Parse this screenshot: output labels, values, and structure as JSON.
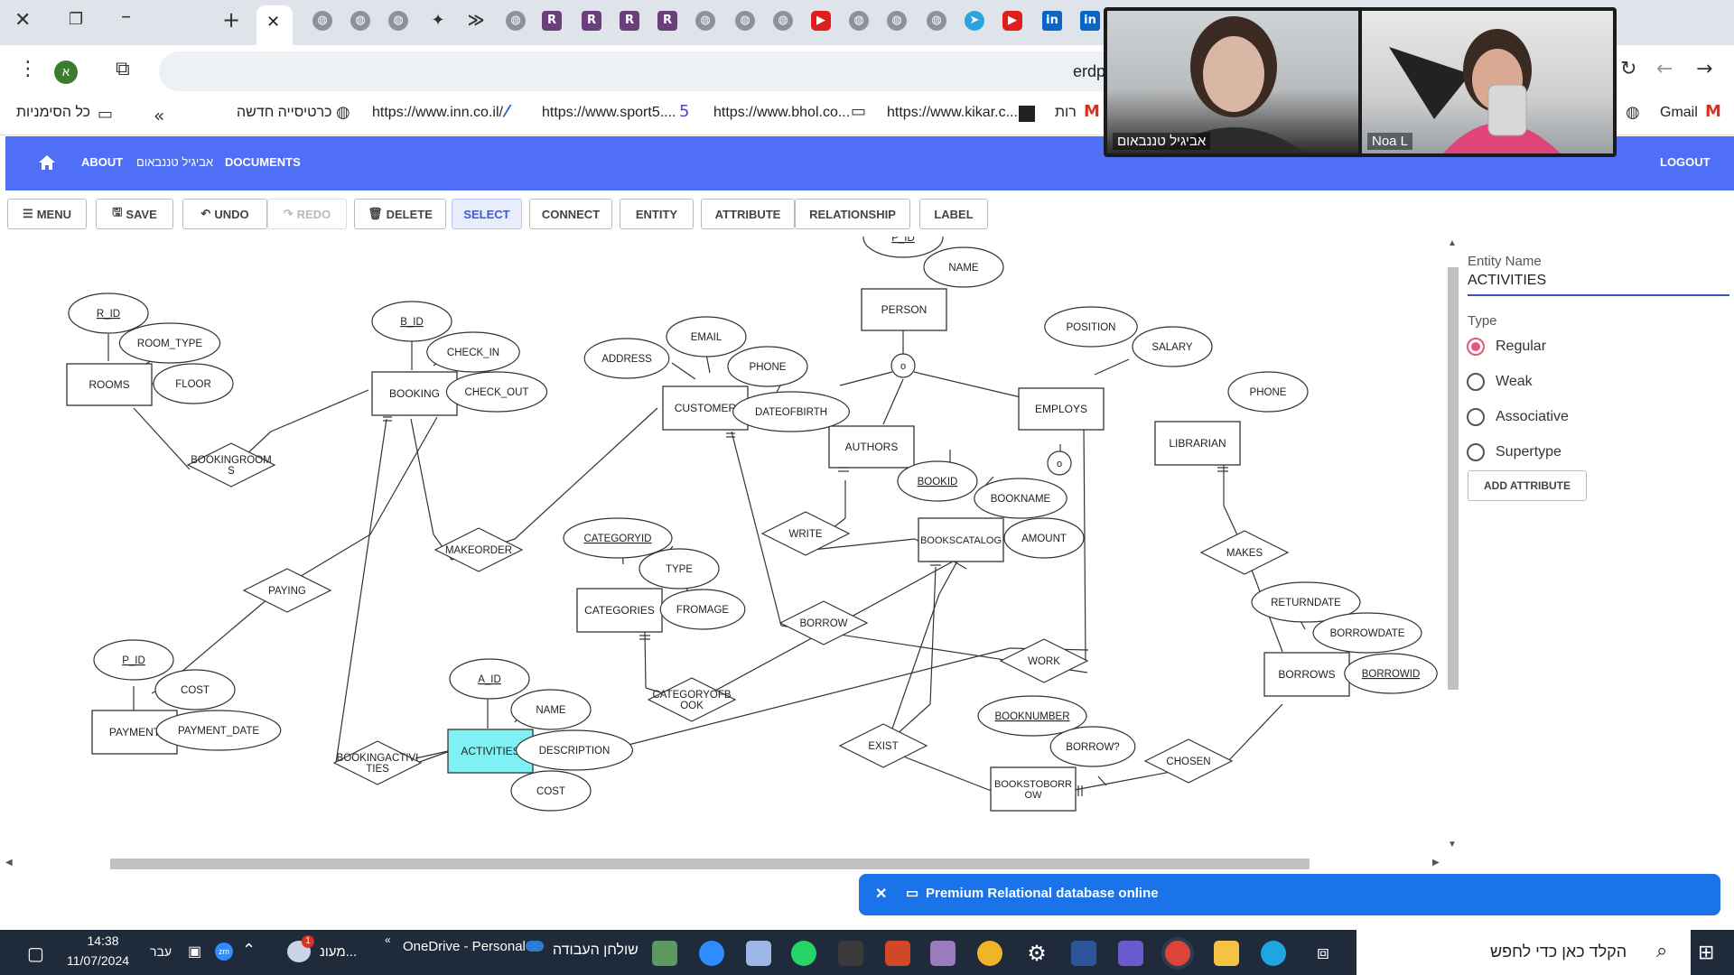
{
  "browser": {
    "address_partial": "erdp",
    "tab_icons": [
      "globe-icon",
      "openai-icon",
      "globe-icon",
      "gemini-icon",
      "terminal-icon",
      "globe-icon",
      "R",
      "R",
      "R",
      "R",
      "globe-icon",
      "camera-icon",
      "globe-icon",
      "youtube-icon",
      "globe-icon",
      "globe-icon",
      "globe-icon",
      "telegram-icon",
      "youtube-icon",
      "linkedin-icon",
      "linkedin-icon"
    ],
    "bookmarks": [
      {
        "label": "כל הסימניות"
      },
      {
        "label": "כרטיסייה חדשה"
      },
      {
        "label": "https://www.inn.co.il/"
      },
      {
        "label": "https://www.sport5...."
      },
      {
        "label": "https://www.bhol.co..."
      },
      {
        "label": "https://www.kikar.c..."
      },
      {
        "label": "רות"
      },
      {
        "label": "Gmail"
      }
    ]
  },
  "video_call": {
    "participants": [
      {
        "name": "אביגיל טננבאום"
      },
      {
        "name": "Noa L"
      }
    ]
  },
  "app": {
    "nav": {
      "about": "ABOUT",
      "user": "אביגיל טננבאום",
      "documents": "DOCUMENTS",
      "logout": "LOGOUT"
    },
    "tools": {
      "menu": "MENU",
      "save": "SAVE",
      "undo": "UNDO",
      "redo": "REDO",
      "delete": "DELETE",
      "select": "SELECT",
      "connect": "CONNECT",
      "entity": "ENTITY",
      "attribute": "ATTRIBUTE",
      "relationship": "RELATIONSHIP",
      "label": "LABEL"
    },
    "panel": {
      "entity_name_label": "Entity Name",
      "entity_name_value": "ACTIVITIES",
      "type_label": "Type",
      "types": [
        "Regular",
        "Weak",
        "Associative",
        "Supertype"
      ],
      "selected_type": "Regular",
      "add_attribute": "ADD ATTRIBUTE"
    },
    "toast": "Premium Relational database online"
  },
  "diagram": {
    "entities": [
      {
        "label": "ROOMS"
      },
      {
        "label": "BOOKING"
      },
      {
        "label": "CUSTOMER"
      },
      {
        "label": "PERSON"
      },
      {
        "label": "AUTHORS"
      },
      {
        "label": "EMPLOYS"
      },
      {
        "label": "LIBRARIAN"
      },
      {
        "label": "BOOKSCATALOG"
      },
      {
        "label": "CATEGORIES"
      },
      {
        "label": "PAYMENT"
      },
      {
        "label": "ACTIVITIES",
        "selected": true
      },
      {
        "label": "BORROWS"
      },
      {
        "label": "BOOKSTOBORR\nOW"
      }
    ],
    "attributes": [
      {
        "label": "R_ID",
        "key": true
      },
      {
        "label": "ROOM_TYPE"
      },
      {
        "label": "FLOOR"
      },
      {
        "label": "B_ID",
        "key": true
      },
      {
        "label": "CHECK_IN"
      },
      {
        "label": "CHECK_OUT"
      },
      {
        "label": "ADDRESS"
      },
      {
        "label": "EMAIL"
      },
      {
        "label": "PHONE"
      },
      {
        "label": "DATEOFBIRTH"
      },
      {
        "label": "P_ID",
        "key": true
      },
      {
        "label": "NAME"
      },
      {
        "label": "POSITION"
      },
      {
        "label": "SALARY"
      },
      {
        "label": "PHONE"
      },
      {
        "label": "BOOKID",
        "key": true
      },
      {
        "label": "BOOKNAME"
      },
      {
        "label": "AMOUNT"
      },
      {
        "label": "CATEGORYID",
        "key": true
      },
      {
        "label": "TYPE"
      },
      {
        "label": "FROMAGE"
      },
      {
        "label": "P_ID",
        "key": true
      },
      {
        "label": "COST"
      },
      {
        "label": "PAYMENT_DATE"
      },
      {
        "label": "A_ID",
        "key": true
      },
      {
        "label": "NAME"
      },
      {
        "label": "DESCRIPTION"
      },
      {
        "label": "COST"
      },
      {
        "label": "RETURNDATE"
      },
      {
        "label": "BORROWDATE"
      },
      {
        "label": "BORROWID",
        "key": true
      },
      {
        "label": "BOOKNUMBER",
        "key": true
      },
      {
        "label": "BORROW?"
      }
    ],
    "relationships": [
      {
        "label": "BOOKINGROOM\nS"
      },
      {
        "label": "MAKEORDER"
      },
      {
        "label": "PAYING"
      },
      {
        "label": "WRITE"
      },
      {
        "label": "BORROW"
      },
      {
        "label": "WORK"
      },
      {
        "label": "MAKES"
      },
      {
        "label": "CATEGORYOFB\nOOK"
      },
      {
        "label": "BOOKINGACTIVI\nTIES"
      },
      {
        "label": "EXIST"
      },
      {
        "label": "CHOSEN"
      }
    ],
    "isa_symbol": "o"
  },
  "taskbar": {
    "time": "14:38",
    "date": "11/07/2024",
    "lang": "עבר",
    "search_placeholder": "הקלד כאן כדי לחפש",
    "onedrive": "OneDrive - Personal",
    "desktop": "שולחן העבודה",
    "weather": "מעונ...",
    "notification_count": "1"
  }
}
